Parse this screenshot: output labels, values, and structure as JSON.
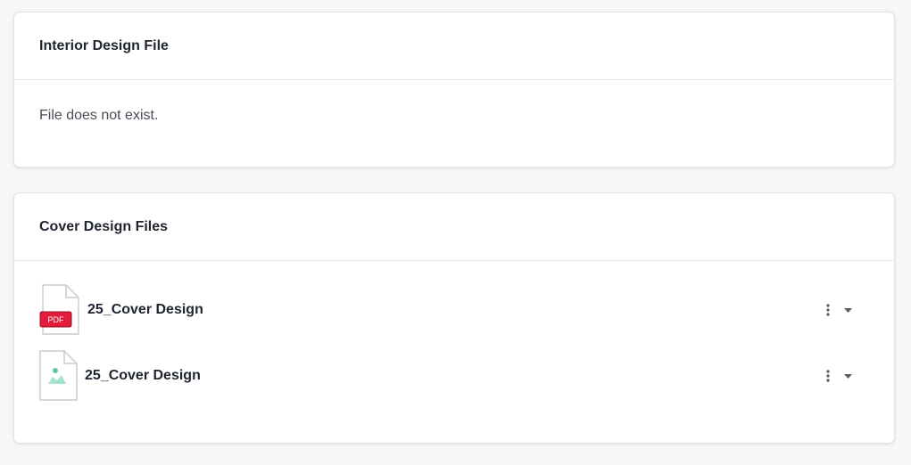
{
  "interior": {
    "title": "Interior Design File",
    "message": "File does not exist."
  },
  "cover": {
    "title": "Cover Design Files",
    "files": [
      {
        "name": "25_Cover Design",
        "type": "pdf",
        "badge": "PDF",
        "icon": "pdf-file-icon"
      },
      {
        "name": "25_Cover Design",
        "type": "image",
        "icon": "image-file-icon"
      }
    ]
  },
  "colors": {
    "pdf_badge": "#e21c3a",
    "image_accent": "#7fd3b2",
    "icon_stroke": "#c9ccd1"
  }
}
